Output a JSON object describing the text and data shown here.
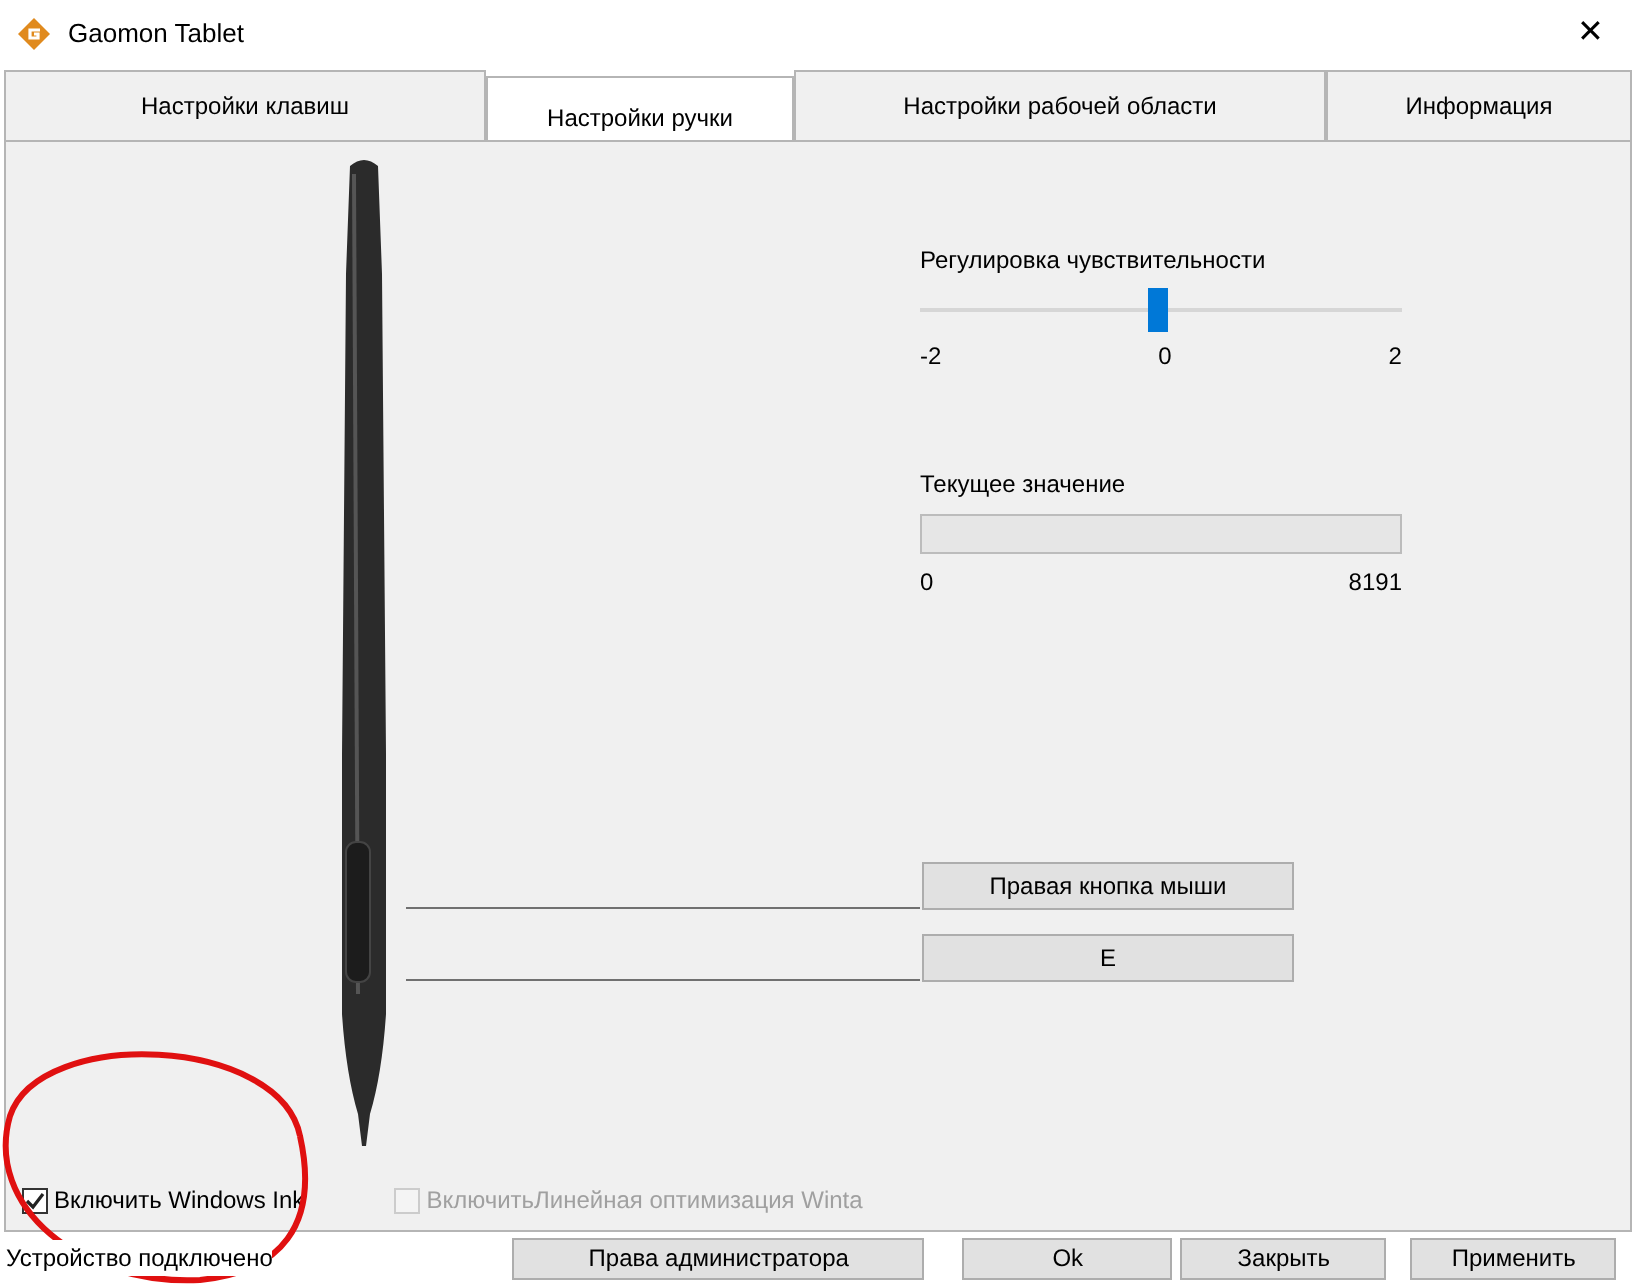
{
  "window": {
    "title": "Gaomon Tablet",
    "close": "✕"
  },
  "tabs": [
    {
      "label": "Настройки клавиш",
      "selected": false
    },
    {
      "label": "Настройки ручки",
      "selected": true
    },
    {
      "label": "Настройки рабочей области",
      "selected": false
    },
    {
      "label": "Информация",
      "selected": false
    }
  ],
  "sensitivity": {
    "label": "Регулировка чувствительности",
    "level": 0.5,
    "min": "-2",
    "mid": "0",
    "max": "2"
  },
  "current_value": {
    "label": "Текущее значение",
    "level": 0,
    "min": "0",
    "max": "8191"
  },
  "pen_buttons": [
    "Правая кнопка мыши",
    "E"
  ],
  "checkboxes": [
    {
      "label": "Включить Windows Ink",
      "checked": true,
      "disabled": false
    },
    {
      "label": "ВключитьЛинейная оптимизация Winta",
      "checked": false,
      "disabled": true
    }
  ],
  "status": "Устройство подключено",
  "buttons": [
    "Права администратора",
    "Ok",
    "Закрыть",
    "Применить"
  ]
}
